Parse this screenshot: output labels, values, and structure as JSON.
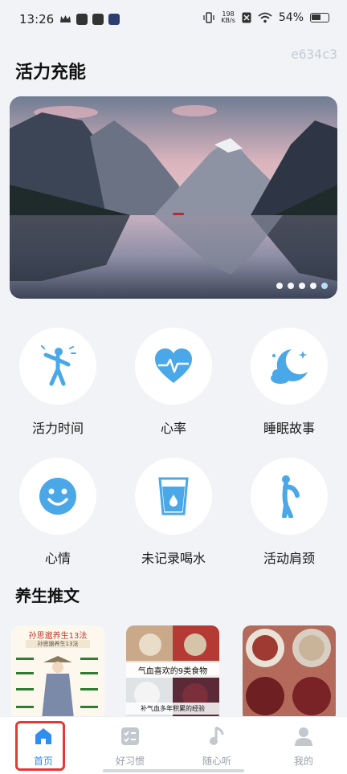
{
  "status_bar": {
    "time": "13:26",
    "net_speed_value": "198",
    "net_speed_unit": "KB/s",
    "battery": "54%"
  },
  "watermark_hex": "e634c3",
  "page_title": "活力充能",
  "banner": {
    "slide_count": 5,
    "active_index": 4
  },
  "features": [
    {
      "label": "活力时间",
      "icon": "person-running-icon"
    },
    {
      "label": "心率",
      "icon": "heart-rate-icon"
    },
    {
      "label": "睡眠故事",
      "icon": "moon-stars-icon"
    },
    {
      "label": "心情",
      "icon": "smiley-face-icon"
    },
    {
      "label": "未记录喝水",
      "icon": "water-glass-icon"
    },
    {
      "label": "活动肩颈",
      "icon": "stretch-pose-icon"
    }
  ],
  "section_title": "养生推文",
  "articles": [
    {
      "header": "孙思邈养生13法",
      "sub": "孙思邈养生13法"
    },
    {
      "header": "气血喜欢的9类食物",
      "sub": "补气血多年积累的经验"
    },
    {
      "header": "",
      "sub": ""
    }
  ],
  "bottom_nav": [
    {
      "label": "首页",
      "icon": "home-icon",
      "active": true
    },
    {
      "label": "好习惯",
      "icon": "checklist-icon",
      "active": false
    },
    {
      "label": "随心听",
      "icon": "music-note-icon",
      "active": false
    },
    {
      "label": "我的",
      "icon": "person-icon",
      "active": false
    }
  ],
  "colors": {
    "accent": "#2f8ef0",
    "icon_blue": "#4aa8e8",
    "highlight": "#e53935",
    "background": "#f1f3f6"
  }
}
